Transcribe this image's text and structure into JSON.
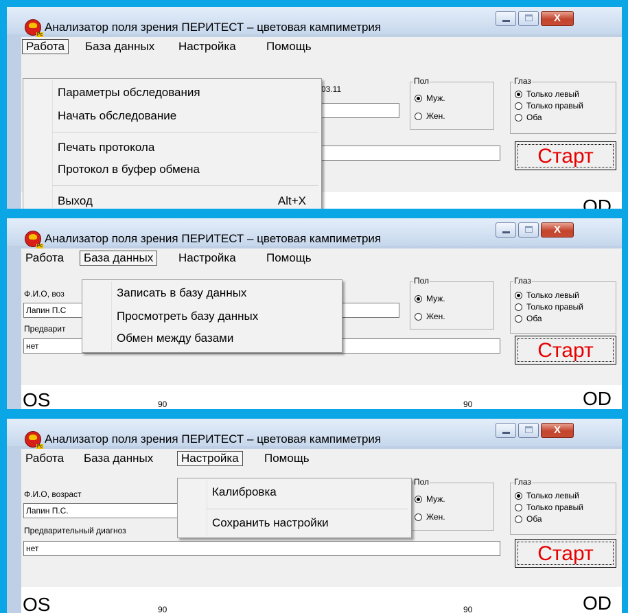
{
  "window": {
    "title": "Анализатор поля зрения ПЕРИТЕСТ – цветовая кампиметрия",
    "close_label": "X"
  },
  "menubar": {
    "work": "Работа",
    "database": "База данных",
    "settings": "Настройка",
    "help": "Помощь"
  },
  "form": {
    "name_label": "Ф.И.О, возраст",
    "name_label_truncated": "Ф.И.О, воз",
    "name_value": "Лапин П.С.",
    "name_value_truncated": "Лапин П.С",
    "date_fragment": "03.11",
    "diagnosis_label": "Предварительный диагноз",
    "diagnosis_label_truncated": "Предварит",
    "diagnosis_value": "нет"
  },
  "sex_group": {
    "legend": "Пол",
    "male": "Муж.",
    "female": "Жен.",
    "selected": "male"
  },
  "eye_group": {
    "legend": "Глаз",
    "left_only": "Только левый",
    "right_only": "Только правый",
    "both": "Оба",
    "selected": "left_only"
  },
  "start_button": "Старт",
  "plot": {
    "os_label": "OS",
    "od_label": "OD",
    "left_angle": "90",
    "right_angle": "90"
  },
  "menus": {
    "work": {
      "items": [
        "Параметры обследования",
        "Начать обследование",
        "Печать протокола",
        "Протокол в буфер обмена",
        "Выход"
      ],
      "exit_shortcut": "Alt+X"
    },
    "database": {
      "items": [
        "Записать в базу данных",
        "Просмотреть базу данных",
        "Обмен между базами"
      ]
    },
    "settings": {
      "items": [
        "Калибровка",
        "Сохранить настройки"
      ]
    }
  },
  "colors": {
    "background_frame": "#0aa6e6",
    "start_text": "#e60000",
    "title_bar": "#c6d7ec"
  }
}
